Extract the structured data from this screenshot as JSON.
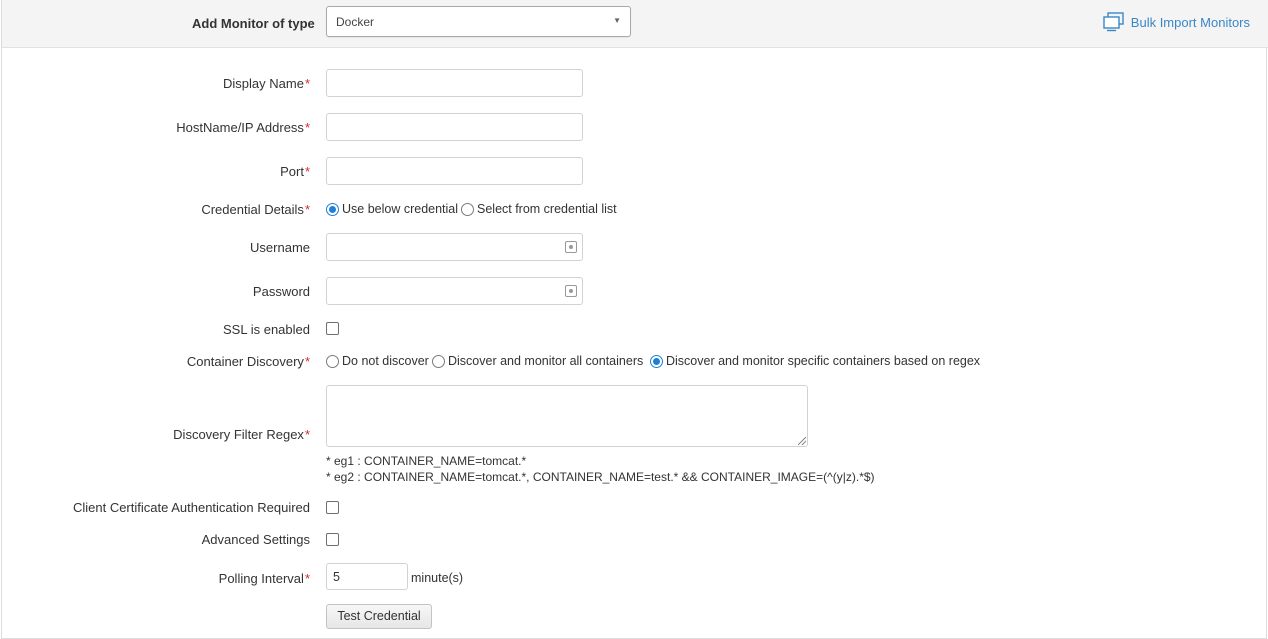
{
  "header": {
    "title": "Add Monitor of type",
    "monitor_type": "Docker",
    "bulk_import_label": "Bulk Import Monitors"
  },
  "form": {
    "display_name": {
      "label": "Display Name",
      "required": "*",
      "value": ""
    },
    "hostname": {
      "label": "HostName/IP Address",
      "required": "*",
      "value": ""
    },
    "port": {
      "label": "Port",
      "required": "*",
      "value": ""
    },
    "credential_details": {
      "label": "Credential Details",
      "required": "*",
      "options": [
        "Use below credential",
        "Select from credential list"
      ],
      "selected": "Use below credential"
    },
    "username": {
      "label": "Username",
      "value": ""
    },
    "password": {
      "label": "Password",
      "value": ""
    },
    "ssl": {
      "label": "SSL is enabled",
      "checked": false
    },
    "container_discovery": {
      "label": "Container Discovery",
      "required": "*",
      "options": [
        "Do not discover",
        "Discover and monitor all containers",
        "Discover and monitor specific containers based on regex"
      ],
      "selected": "Discover and monitor specific containers based on regex"
    },
    "discovery_filter": {
      "label": "Discovery Filter Regex",
      "required": "*",
      "value": "",
      "hint1": "* eg1 : CONTAINER_NAME=tomcat.*",
      "hint2": "* eg2 : CONTAINER_NAME=tomcat.*, CONTAINER_NAME=test.* && CONTAINER_IMAGE=(^(y|z).*$)"
    },
    "client_cert": {
      "label": "Client Certificate Authentication Required",
      "checked": false
    },
    "advanced": {
      "label": "Advanced Settings",
      "checked": false
    },
    "polling": {
      "label": "Polling Interval",
      "required": "*",
      "value": "5",
      "unit": "minute(s)"
    },
    "test_button": "Test Credential"
  },
  "colors": {
    "accent": "#1e7fd6",
    "link": "#3a87c8",
    "required": "#d9262f"
  }
}
